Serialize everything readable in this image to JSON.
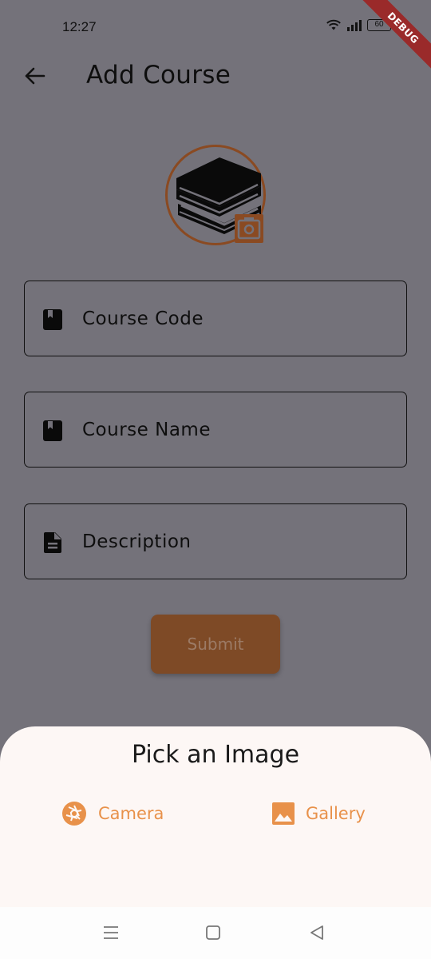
{
  "status_bar": {
    "time": "12:27",
    "battery": "60"
  },
  "debug_banner": "DEBUG",
  "app_bar": {
    "back_icon": "arrow-left-icon",
    "title": "Add Course"
  },
  "avatar": {
    "image_icon": "books-icon",
    "badge_icon": "camera-icon"
  },
  "form": {
    "fields": [
      {
        "icon": "book-icon",
        "label": "Course Code"
      },
      {
        "icon": "book-icon",
        "label": "Course Name"
      },
      {
        "icon": "document-icon",
        "label": "Description"
      }
    ],
    "submit_label": "Submit"
  },
  "bottom_sheet": {
    "title": "Pick an Image",
    "options": [
      {
        "icon": "camera-aperture-icon",
        "label": "Camera"
      },
      {
        "icon": "image-icon",
        "label": "Gallery"
      }
    ]
  },
  "nav_bar": {
    "items": [
      "menu-icon",
      "home-icon",
      "back-triangle-icon"
    ]
  },
  "colors": {
    "accent": "#e8914a",
    "brown": "#8a4a22",
    "overlay": "#74727a",
    "sheet": "#fdf7f5"
  }
}
